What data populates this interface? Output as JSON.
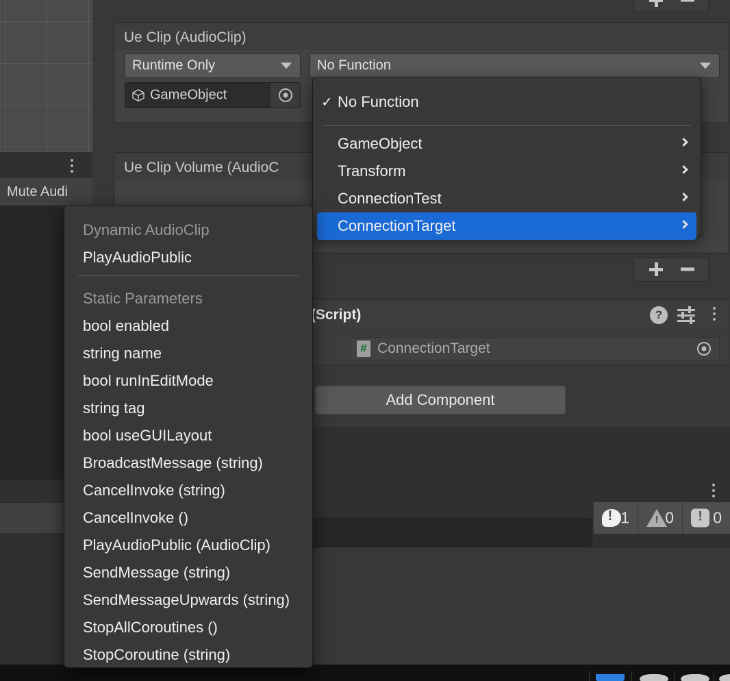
{
  "scene_view": {
    "name": "scene-grid"
  },
  "scene_tabbar": {
    "kebab": "more-options"
  },
  "mute_audio": {
    "label": "Mute Audi"
  },
  "event_entries": [
    {
      "title": "Ue Clip (AudioClip)",
      "runtime_mode": "Runtime Only",
      "object_ref": "GameObject",
      "function": "No Function"
    },
    {
      "title": "Ue Clip Volume (AudioC",
      "runtime_mode": "",
      "object_ref": "",
      "function": ""
    }
  ],
  "plus_minus": {
    "plus": "+",
    "minus": "-"
  },
  "script_component": {
    "header_title": "t (Script)",
    "script_value": "ConnectionTarget",
    "icons": {
      "help": "?",
      "preset": "preset-icon",
      "kebab": "more-options"
    }
  },
  "add_component": {
    "label": "Add Component"
  },
  "function_menu": {
    "items": [
      {
        "label": "No Function",
        "checked": true,
        "submenu": false,
        "selected": false
      },
      {
        "label": "GameObject",
        "checked": false,
        "submenu": true,
        "selected": false
      },
      {
        "label": "Transform",
        "checked": false,
        "submenu": true,
        "selected": false
      },
      {
        "label": "ConnectionTest",
        "checked": false,
        "submenu": true,
        "selected": false
      },
      {
        "label": "ConnectionTarget",
        "checked": false,
        "submenu": true,
        "selected": true
      }
    ],
    "check_glyph": "✓",
    "accent_color": "#1a6ad6"
  },
  "method_submenu": {
    "rows": [
      {
        "label": "Dynamic AudioClip",
        "type": "header"
      },
      {
        "label": "PlayAudioPublic",
        "type": "item"
      },
      {
        "label": "",
        "type": "divider"
      },
      {
        "label": "Static Parameters",
        "type": "header"
      },
      {
        "label": "bool enabled",
        "type": "item"
      },
      {
        "label": "string name",
        "type": "item"
      },
      {
        "label": "bool runInEditMode",
        "type": "item"
      },
      {
        "label": "string tag",
        "type": "item"
      },
      {
        "label": "bool useGUILayout",
        "type": "item"
      },
      {
        "label": "BroadcastMessage (string)",
        "type": "item"
      },
      {
        "label": "CancelInvoke (string)",
        "type": "item"
      },
      {
        "label": "CancelInvoke ()",
        "type": "item"
      },
      {
        "label": "PlayAudioPublic (AudioClip)",
        "type": "item"
      },
      {
        "label": "SendMessage (string)",
        "type": "item"
      },
      {
        "label": "SendMessageUpwards (string)",
        "type": "item"
      },
      {
        "label": "StopAllCoroutines ()",
        "type": "item"
      },
      {
        "label": "StopCoroutine (string)",
        "type": "item"
      }
    ]
  },
  "status_counters": {
    "errors": "1",
    "warnings": "0",
    "infos": "0"
  },
  "console_panel": {
    "search_value": "",
    "kebab": "more-options"
  }
}
